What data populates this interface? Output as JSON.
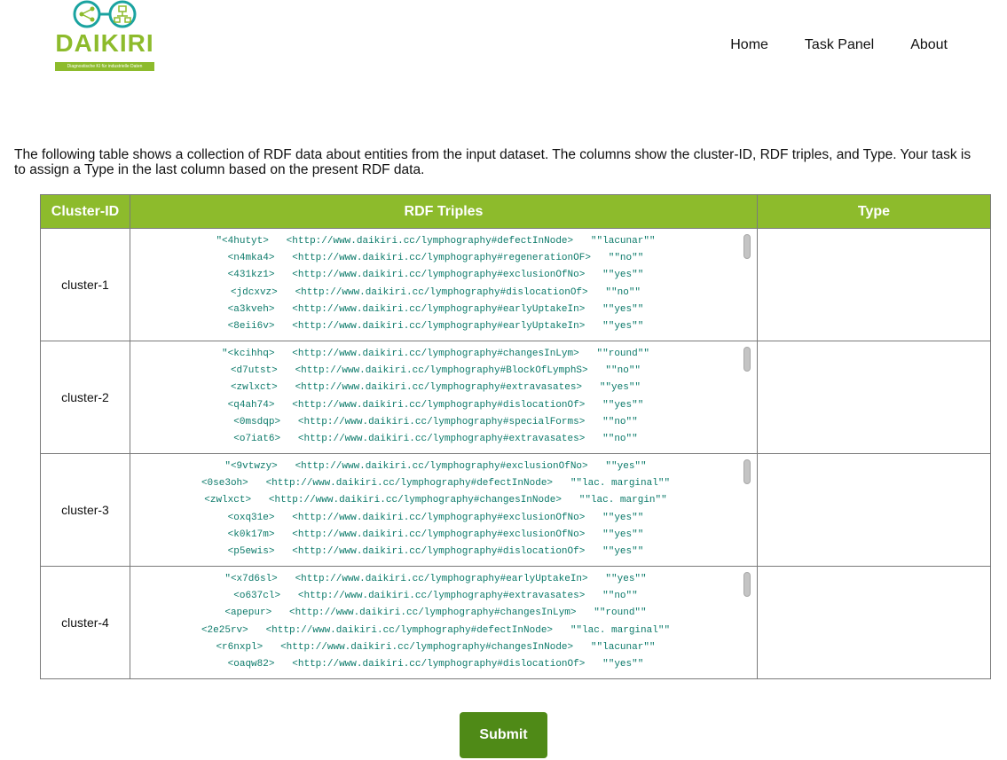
{
  "header": {
    "logo_text": "DAIKIRI",
    "logo_subtitle": "Diagnostische KI für industrielle Daten",
    "nav": [
      "Home",
      "Task Panel",
      "About"
    ]
  },
  "intro": "The following table shows a collection of RDF data about entities from the input dataset. The columns show the cluster-ID, RDF triples, and Type. Your task is to assign a Type in the last column based on the present RDF data.",
  "table": {
    "headers": [
      "Cluster-ID",
      "RDF Triples",
      "Type"
    ],
    "rows": [
      {
        "cluster": "cluster-1",
        "triples": [
          "\"<4hutyt>   <http://www.daikiri.cc/lymphography#defectInNode>   \"\"lacunar\"\"",
          "<n4mka4>   <http://www.daikiri.cc/lymphography#regenerationOF>   \"\"no\"\"",
          "<431kz1>   <http://www.daikiri.cc/lymphography#exclusionOfNo>   \"\"yes\"\"",
          "<jdcxvz>   <http://www.daikiri.cc/lymphography#dislocationOf>   \"\"no\"\"",
          "<a3kveh>   <http://www.daikiri.cc/lymphography#earlyUptakeIn>   \"\"yes\"\"",
          "<8eii6v>   <http://www.daikiri.cc/lymphography#earlyUptakeIn>   \"\"yes\"\""
        ]
      },
      {
        "cluster": "cluster-2",
        "triples": [
          "\"<kcihhq>   <http://www.daikiri.cc/lymphography#changesInLym>   \"\"round\"\"",
          "<d7utst>   <http://www.daikiri.cc/lymphography#BlockOfLymphS>   \"\"no\"\"",
          "<zwlxct>   <http://www.daikiri.cc/lymphography#extravasates>   \"\"yes\"\"",
          "<q4ah74>   <http://www.daikiri.cc/lymphography#dislocationOf>   \"\"yes\"\"",
          "<0msdqp>   <http://www.daikiri.cc/lymphography#specialForms>   \"\"no\"\"",
          "<o7iat6>   <http://www.daikiri.cc/lymphography#extravasates>   \"\"no\"\""
        ]
      },
      {
        "cluster": "cluster-3",
        "triples": [
          "\"<9vtwzy>   <http://www.daikiri.cc/lymphography#exclusionOfNo>   \"\"yes\"\"",
          "<0se3oh>   <http://www.daikiri.cc/lymphography#defectInNode>   \"\"lac. marginal\"\"",
          "<zwlxct>   <http://www.daikiri.cc/lymphography#changesInNode>   \"\"lac. margin\"\"",
          "<oxq31e>   <http://www.daikiri.cc/lymphography#exclusionOfNo>   \"\"yes\"\"",
          "<k0k17m>   <http://www.daikiri.cc/lymphography#exclusionOfNo>   \"\"yes\"\"",
          "<p5ewis>   <http://www.daikiri.cc/lymphography#dislocationOf>   \"\"yes\"\""
        ]
      },
      {
        "cluster": "cluster-4",
        "triples": [
          "\"<x7d6sl>   <http://www.daikiri.cc/lymphography#earlyUptakeIn>   \"\"yes\"\"",
          "<o637cl>   <http://www.daikiri.cc/lymphography#extravasates>   \"\"no\"\"",
          "<apepur>   <http://www.daikiri.cc/lymphography#changesInLym>   \"\"round\"\"",
          "<2e25rv>   <http://www.daikiri.cc/lymphography#defectInNode>   \"\"lac. marginal\"\"",
          "<r6nxpl>   <http://www.daikiri.cc/lymphography#changesInNode>   \"\"lacunar\"\"",
          "<oaqw82>   <http://www.daikiri.cc/lymphography#dislocationOf>   \"\"yes\"\""
        ]
      }
    ]
  },
  "submit_label": "Submit",
  "colors": {
    "brand_green": "#8dbb2c",
    "button_green": "#4f8a17",
    "triple_text": "#0c7a6a"
  }
}
